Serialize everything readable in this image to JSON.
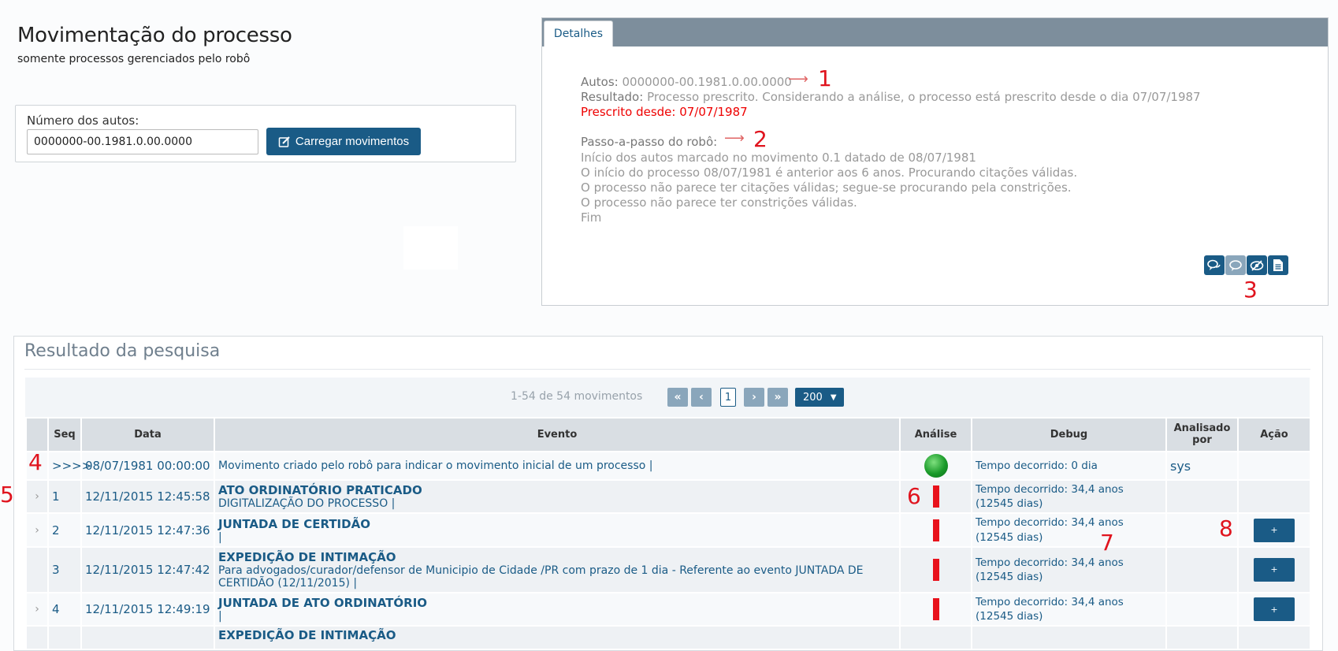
{
  "header": {
    "title": "Movimentação do processo",
    "subtitle": "somente processos gerenciados pelo robô"
  },
  "search": {
    "label": "Número dos autos:",
    "value": "0000000-00.1981.0.00.0000",
    "button_label": "Carregar movimentos",
    "button_icon": "edit-icon"
  },
  "details": {
    "tab_label": "Detalhes",
    "autos_key": "Autos",
    "autos_value": "0000000-00.1981.0.00.0000",
    "resultado_key": "Resultado",
    "resultado_value": "Processo prescrito. Considerando a análise, o processo está prescrito desde o dia 07/07/1987",
    "prescrito_key": "Prescrito desde",
    "prescrito_value": "07/07/1987",
    "steps_title": "Passo-a-passo do robô:",
    "steps": [
      "Início dos autos marcado no movimento 0.1 datado de 08/07/1981",
      "O início do processo 08/07/1981 é anterior aos 6 anos. Procurando citações válidas.",
      "O processo não parece ter citações válidas; segue-se procurando pela constrições.",
      "O processo não parece ter constrições válidas.",
      "Fim"
    ],
    "icons": [
      "chat-icon",
      "comment-icon",
      "eye-slash-icon",
      "document-icon"
    ],
    "colors": {
      "key": "#777777",
      "value": "#999999",
      "red": "#ee0000"
    }
  },
  "annotations": [
    "1",
    "2",
    "3",
    "4",
    "5",
    "6",
    "7",
    "8"
  ],
  "results": {
    "title": "Resultado da pesquisa",
    "pager_info": "1-54 de 54 movimentos",
    "current_page": "1",
    "page_size": "200",
    "columns": [
      "",
      "Seq",
      "Data",
      "Evento",
      "Análise",
      "Debug",
      "Analisado por",
      "Ação"
    ],
    "rows": [
      {
        "expand": "",
        "seq": ">>>>",
        "date": "08/07/1981 00:00:00",
        "event_title": "",
        "event_desc": "Movimento criado pelo robô para indicar o movimento inicial de um processo |",
        "analysis": "green",
        "debug": "Tempo decorrido: 0 dia",
        "analyzed_by": "sys",
        "action": ""
      },
      {
        "expand": "›",
        "seq": "1",
        "date": "12/11/2015 12:45:58",
        "event_title": "ATO ORDINATÓRIO PRATICADO",
        "event_desc": "DIGITALIZAÇÃO DO PROCESSO |",
        "analysis": "red",
        "debug": "Tempo decorrido: 34,4 anos (12545 dias)",
        "analyzed_by": "",
        "action": ""
      },
      {
        "expand": "›",
        "seq": "2",
        "date": "12/11/2015 12:47:36",
        "event_title": "JUNTADA DE CERTIDÃO",
        "event_desc": "|",
        "analysis": "red",
        "debug": "Tempo decorrido: 34,4 anos (12545 dias)",
        "analyzed_by": "",
        "action": "+"
      },
      {
        "expand": "",
        "seq": "3",
        "date": "12/11/2015 12:47:42",
        "event_title": "EXPEDIÇÃO DE INTIMAÇÃO",
        "event_desc": "Para advogados/curador/defensor de Municipio de Cidade /PR com prazo de 1 dia - Referente ao evento JUNTADA DE CERTIDÃO (12/11/2015) |",
        "analysis": "red",
        "debug": "Tempo decorrido: 34,4 anos (12545 dias)",
        "analyzed_by": "",
        "action": "+"
      },
      {
        "expand": "›",
        "seq": "4",
        "date": "12/11/2015 12:49:19",
        "event_title": "JUNTADA DE ATO ORDINATÓRIO",
        "event_desc": "|",
        "analysis": "red",
        "debug": "Tempo decorrido: 34,4 anos (12545 dias)",
        "analyzed_by": "",
        "action": "+"
      },
      {
        "expand": "",
        "seq": "",
        "date": "",
        "event_title": "EXPEDIÇÃO DE INTIMAÇÃO",
        "event_desc": "",
        "analysis": "",
        "debug": "",
        "analyzed_by": "",
        "action": ""
      }
    ]
  }
}
